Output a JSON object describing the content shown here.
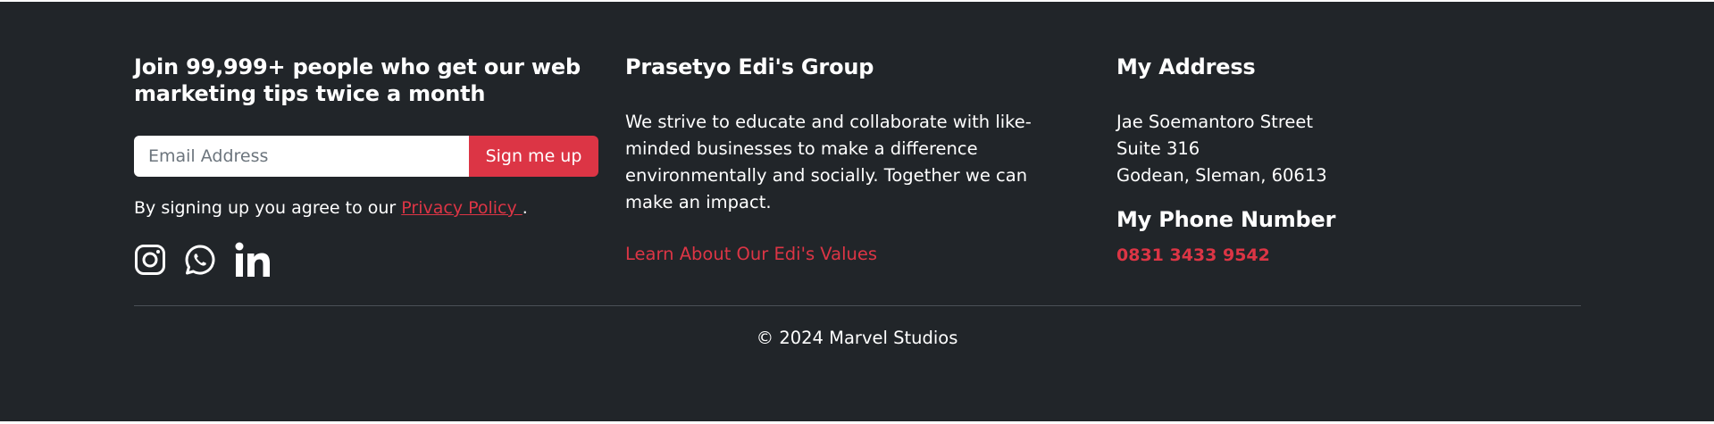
{
  "newsletter": {
    "heading": "Join 99,999+ people who get our web marketing tips twice a month",
    "email_placeholder": "Email Address",
    "button_label": "Sign me up",
    "agree_text": "By signing up you agree to our ",
    "privacy_link": "Privacy Policy ",
    "agree_suffix": "."
  },
  "socials": {
    "icons": [
      "instagram-icon",
      "whatsapp-icon",
      "linkedin-icon"
    ]
  },
  "about": {
    "heading": "Prasetyo Edi's Group",
    "description": "We strive to educate and collaborate with like-minded businesses to make a difference environmentally and socially. Together we can make an impact.",
    "link": "Learn About Our Edi's Values"
  },
  "address": {
    "heading": "My Address",
    "line1": "Jae Soemantoro Street",
    "line2": "Suite 316",
    "line3": "Godean, Sleman, 60613"
  },
  "phone": {
    "heading": "My Phone Number",
    "number": "0831 3433 9542"
  },
  "footer": {
    "copyright": "© 2024 Marvel Studios"
  },
  "colors": {
    "background": "#212529",
    "accent": "#dc3545",
    "text": "#ffffff"
  }
}
